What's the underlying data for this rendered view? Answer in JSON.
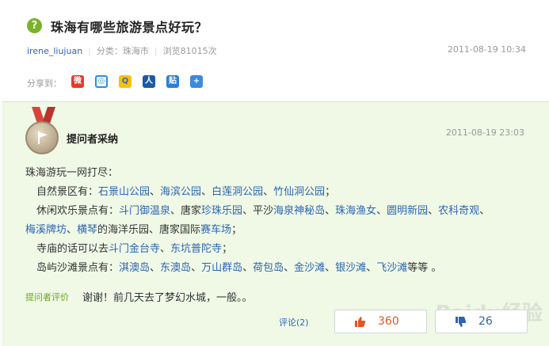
{
  "question": {
    "icon_text": "?",
    "title": "珠海有哪些旅游景点好玩？",
    "user": "irene_liujuan",
    "category": "分类：珠海市",
    "views": "浏览81015次",
    "time": "2011-08-19 10:34",
    "share_label": "分享到：",
    "share_icons": [
      "weibo-icon",
      "qzone-icon",
      "qq-icon",
      "renren-icon",
      "tieba-icon",
      "more-icon"
    ]
  },
  "answer": {
    "title": "提问者采纳",
    "time": "2011-08-19 23:03",
    "intro": "珠海游玩一网打尽：",
    "nature_label": "自然景区有：",
    "nature_spots": [
      "石景山公园",
      "海滨公园",
      "白莲洞公园",
      "竹仙洞公园"
    ],
    "leisure_label": "休闲欢乐景点有：",
    "leisure_a": "斗门御温泉",
    "leisure_b_prefix": "、唐家",
    "leisure_b": "珍珠乐园",
    "leisure_c_prefix": "、平沙",
    "leisure_c": "海泉神秘岛",
    "leisure_d": "珠海渔女",
    "leisure_e": "圆明新园",
    "leisure_f": "农科奇观",
    "leisure_g": "梅溪牌坊",
    "leisure_h": "横琴",
    "leisure_h_suffix": "的海洋乐园、唐家国际",
    "leisure_i": "赛车场",
    "temple_label": "寺庙的话可以去",
    "temple_a": "斗门金台寺",
    "temple_b": "东坑普陀寺",
    "island_label": "岛屿沙滩景点有：",
    "island_spots": [
      "淇澳岛",
      "东澳岛",
      "万山群岛",
      "荷包岛",
      "金沙滩",
      "银沙滩",
      "飞沙滩"
    ],
    "island_suffix": "等等 。",
    "comment_label": "提问者评价",
    "comment_text": "谢谢！前几天去了梦幻水城，一般。。",
    "comments_link": "评论(2)",
    "upvotes": "360",
    "downvotes": "26",
    "watermark": "Baidu经验"
  }
}
